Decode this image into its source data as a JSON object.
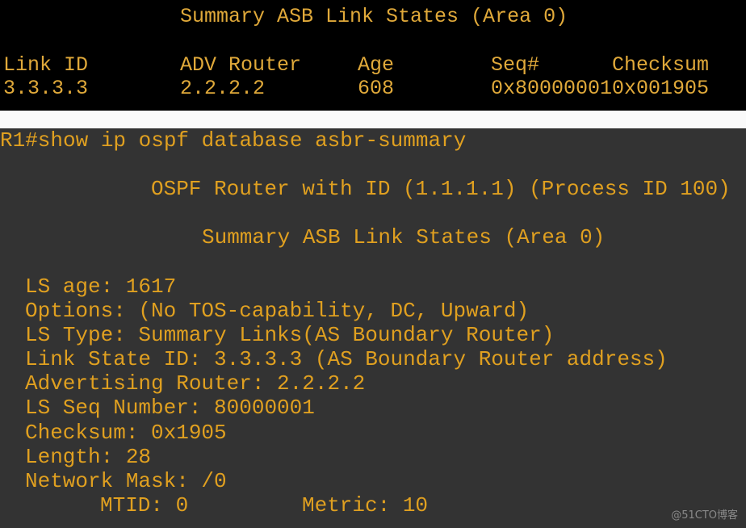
{
  "top_table": {
    "title": "Summary ASB Link States (Area 0)",
    "columns": [
      "Link ID",
      "ADV Router",
      "Age",
      "Seq#",
      "Checksum"
    ],
    "rows": [
      [
        "3.3.3.3",
        "2.2.2.2",
        "608",
        "0x80000001",
        "0x001905"
      ]
    ]
  },
  "terminal": {
    "prompt_command": "R1#show ip ospf database asbr-summary",
    "router_header": "OSPF Router with ID (1.1.1.1) (Process ID 100)",
    "section_header": "Summary ASB Link States (Area 0)",
    "fields": [
      "LS age: 1617",
      "Options: (No TOS-capability, DC, Upward)",
      "LS Type: Summary Links(AS Boundary Router)",
      "Link State ID: 3.3.3.3 (AS Boundary Router address)",
      "Advertising Router: 2.2.2.2",
      "LS Seq Number: 80000001",
      "Checksum: 0x1905",
      "Length: 28",
      "Network Mask: /0"
    ],
    "mtid_label": "MTID: 0",
    "metric_label": "Metric: 10"
  },
  "watermark": "@51CTO博客",
  "colors": {
    "top_bg": "#000000",
    "bottom_bg": "#333333",
    "text": "#e0a020"
  }
}
